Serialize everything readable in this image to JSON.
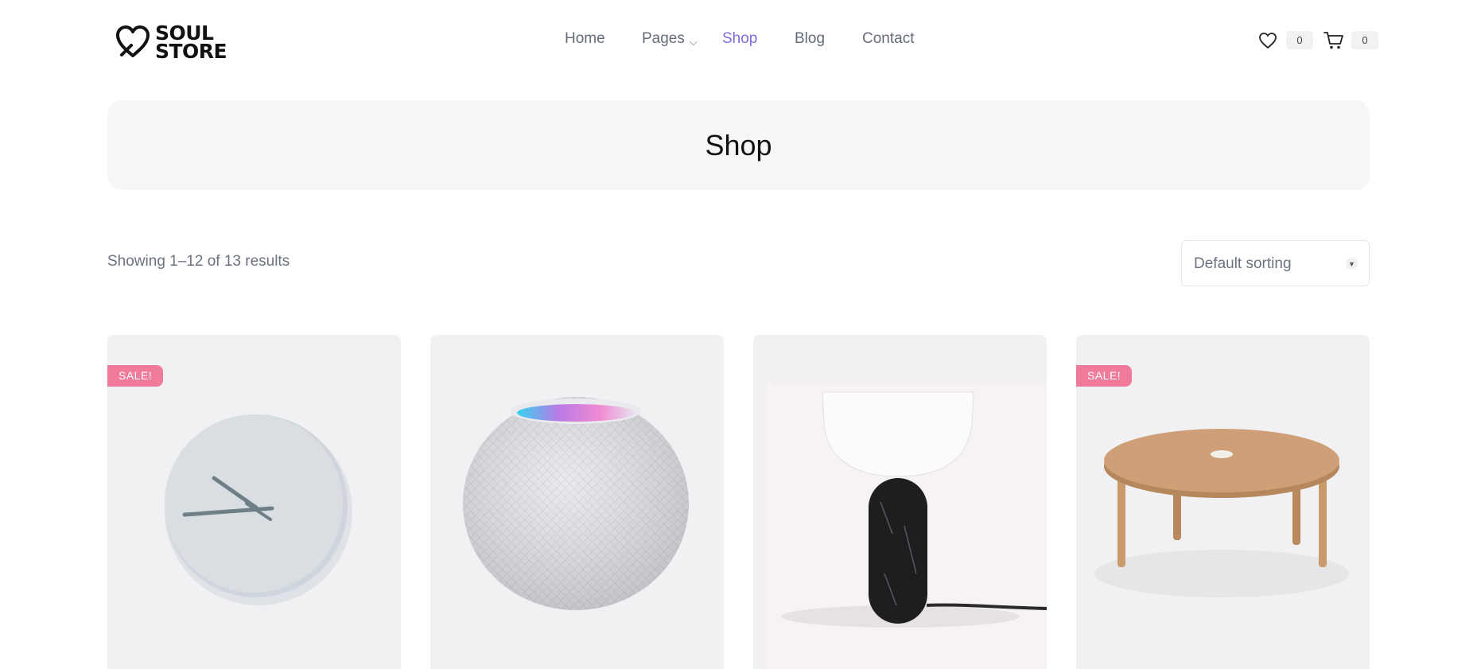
{
  "header": {
    "logo": {
      "line1": "SOUL",
      "line2": "STORE",
      "icon": "heart-logo-icon"
    },
    "nav": [
      {
        "label": "Home",
        "active": false
      },
      {
        "label": "Pages",
        "active": false,
        "has_dropdown": true
      },
      {
        "label": "Shop",
        "active": true
      },
      {
        "label": "Blog",
        "active": false
      },
      {
        "label": "Contact",
        "active": false
      }
    ],
    "wishlist": {
      "icon": "heart-icon",
      "count": "0"
    },
    "cart": {
      "icon": "cart-icon",
      "count": "0"
    }
  },
  "page": {
    "title": "Shop"
  },
  "toolbar": {
    "results_text": "Showing 1–12 of 13 results",
    "sort_selected": "Default sorting"
  },
  "products": [
    {
      "image": "wall-clock",
      "badge": "SALE!"
    },
    {
      "image": "smart-speaker",
      "badge": ""
    },
    {
      "image": "table-lamp",
      "badge": ""
    },
    {
      "image": "round-coffee-table",
      "badge": "SALE!"
    }
  ],
  "colors": {
    "accent": "#7b6fdc",
    "sale_badge": "#f07a99",
    "banner_bg": "#f5f6f8",
    "card_bg": "#f1f1f3"
  }
}
